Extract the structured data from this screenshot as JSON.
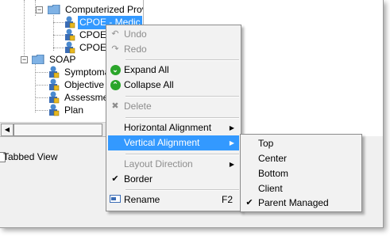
{
  "tree": {
    "nodes": [
      {
        "label": "Computerized Prov",
        "type": "folder"
      },
      {
        "label": "CPOE - Medic",
        "type": "doc",
        "selected": true
      },
      {
        "label": "CPOE",
        "type": "doc"
      },
      {
        "label": "CPOE",
        "type": "doc"
      },
      {
        "label": "SOAP",
        "type": "folder"
      },
      {
        "label": "Symptoma",
        "type": "doc"
      },
      {
        "label": "Objective",
        "type": "doc"
      },
      {
        "label": "Assessme",
        "type": "doc"
      },
      {
        "label": "Plan",
        "type": "doc"
      }
    ]
  },
  "tabbed_view": {
    "label": "Tabbed View"
  },
  "context_menu": {
    "undo": "Undo",
    "redo": "Redo",
    "expand_all": "Expand All",
    "collapse_all": "Collapse All",
    "delete": "Delete",
    "horizontal_alignment": "Horizontal Alignment",
    "vertical_alignment": "Vertical Alignment",
    "layout_direction": "Layout Direction",
    "border": "Border",
    "rename": "Rename",
    "rename_shortcut": "F2"
  },
  "submenu": {
    "items": [
      "Top",
      "Center",
      "Bottom",
      "Client",
      "Parent Managed"
    ],
    "checked": "Parent Managed"
  },
  "colors": {
    "highlight": "#3399ff",
    "green_icon": "#2aa52a",
    "disabled": "#8d8d8d"
  }
}
